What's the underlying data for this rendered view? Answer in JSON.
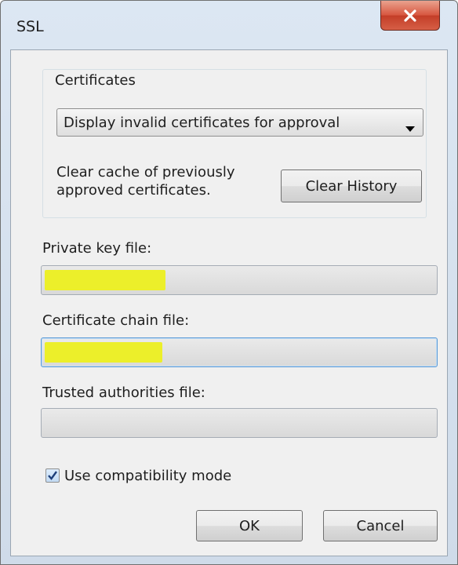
{
  "window": {
    "title": "SSL",
    "close_icon": "close-icon",
    "close_color": "#c94a33"
  },
  "certificates": {
    "group_label": "Certificates",
    "dropdown_selected": "Display invalid certificates for approval",
    "clear_description": "Clear cache of previously approved certificates.",
    "clear_button_label": "Clear History"
  },
  "fields": {
    "private_key_label": "Private key file:",
    "private_key_value": "",
    "chain_label": "Certificate chain file:",
    "chain_value": "",
    "trusted_label": "Trusted authorities file:",
    "trusted_value": ""
  },
  "compatibility": {
    "label": "Use compatibility mode",
    "checked": true
  },
  "buttons": {
    "ok_label": "OK",
    "cancel_label": "Cancel"
  },
  "colors": {
    "highlight": "#ecef2a",
    "focus_border": "#5b9ad6"
  }
}
